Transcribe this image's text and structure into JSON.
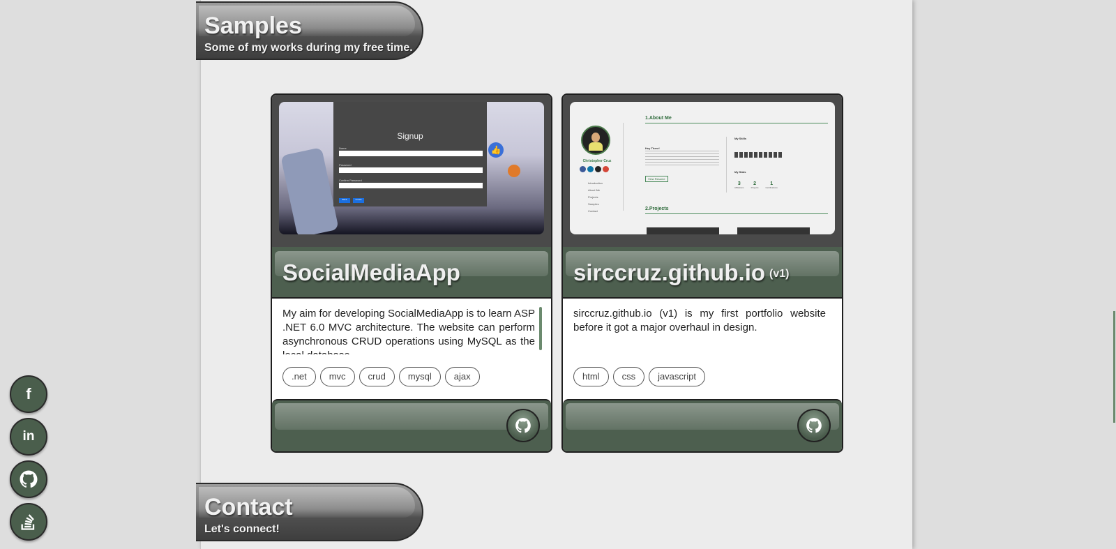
{
  "sections": {
    "samples": {
      "title": "Samples",
      "subtitle": "Some of my works during my free time."
    },
    "contact": {
      "title": "Contact",
      "subtitle": "Let's connect!"
    }
  },
  "cards": [
    {
      "title": "SocialMediaApp",
      "version": "",
      "description": "My aim for developing SocialMediaApp is to learn ASP .NET 6.0 MVC architecture. The website can perform asynchronous CRUD operations using MySQL as the local database.",
      "tags": [
        ".net",
        "mvc",
        "crud",
        "mysql",
        "ajax"
      ],
      "preview": {
        "heading": "Signup",
        "fields": [
          "Name",
          "Password",
          "Confirm Password"
        ],
        "buttons": [
          "Back",
          "Create"
        ]
      },
      "github_icon": "github-icon"
    },
    {
      "title": "sirccruz.github.io",
      "version": "(v1)",
      "description": "sirccruz.github.io (v1) is my first portfolio website before it got a major overhaul in design.",
      "tags": [
        "html",
        "css",
        "javascript"
      ],
      "preview": {
        "name": "Christopher Cruz",
        "nav": [
          "Introduction",
          "About Me",
          "Projects",
          "Samples",
          "Contact"
        ],
        "about_heading": "1.About Me",
        "projects_heading": "2.Projects",
        "greeting": "Hey There!",
        "skills_heading": "My Skills",
        "stats_heading": "My Stats",
        "stats": [
          {
            "value": "3",
            "label": "Affiliations"
          },
          {
            "value": "2",
            "label": "Projects"
          },
          {
            "value": "1",
            "label": "Certifications"
          }
        ],
        "resume_button": "View Resume"
      },
      "github_icon": "github-icon"
    }
  ],
  "social": [
    {
      "name": "facebook-icon",
      "glyph": "f"
    },
    {
      "name": "linkedin-icon",
      "glyph": "in"
    },
    {
      "name": "github-icon",
      "glyph": ""
    },
    {
      "name": "stackoverflow-icon",
      "glyph": ""
    }
  ],
  "colors": {
    "accent_green": "#4d5f4f",
    "page_bg": "#ececec",
    "outer_bg": "#dedede",
    "banner_dark": "#3e3e3e"
  }
}
